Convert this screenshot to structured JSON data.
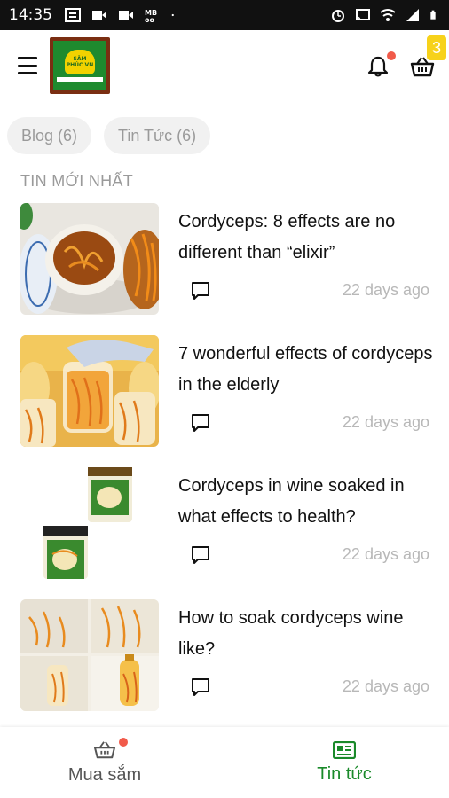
{
  "status_bar": {
    "time": "14:35",
    "left_icons": [
      "notification-box-icon",
      "video-icon",
      "video-icon",
      "mb-icon",
      "dot-icon"
    ],
    "right_icons": [
      "alarm-icon",
      "cast-icon",
      "wifi-icon",
      "signal-icon",
      "battery-icon"
    ]
  },
  "header": {
    "logo_text": "SÂM PHÚC VN",
    "cart_count": "3",
    "accent_badge_color": "#f7d21a",
    "notification_dot_color": "#f15a4a"
  },
  "filters": [
    {
      "label": "Blog (6)"
    },
    {
      "label": "Tin Tức (6)"
    }
  ],
  "section_title": "TIN MỚI NHẤT",
  "articles": [
    {
      "title": "Cordyceps: 8 effects are no different than “elixir”",
      "date": "22 days ago"
    },
    {
      "title": "7 wonderful effects of cordyceps in the elderly",
      "date": "22 days ago"
    },
    {
      "title": "Cordyceps in wine soaked in what effects to health?",
      "date": "22 days ago"
    },
    {
      "title": "How to soak cordyceps wine like?",
      "date": "22 days ago"
    }
  ],
  "bottom_nav": {
    "shop_label": "Mua sắm",
    "news_label": "Tin tức",
    "active_color": "#1a8a2a",
    "inactive_color": "#555555"
  }
}
